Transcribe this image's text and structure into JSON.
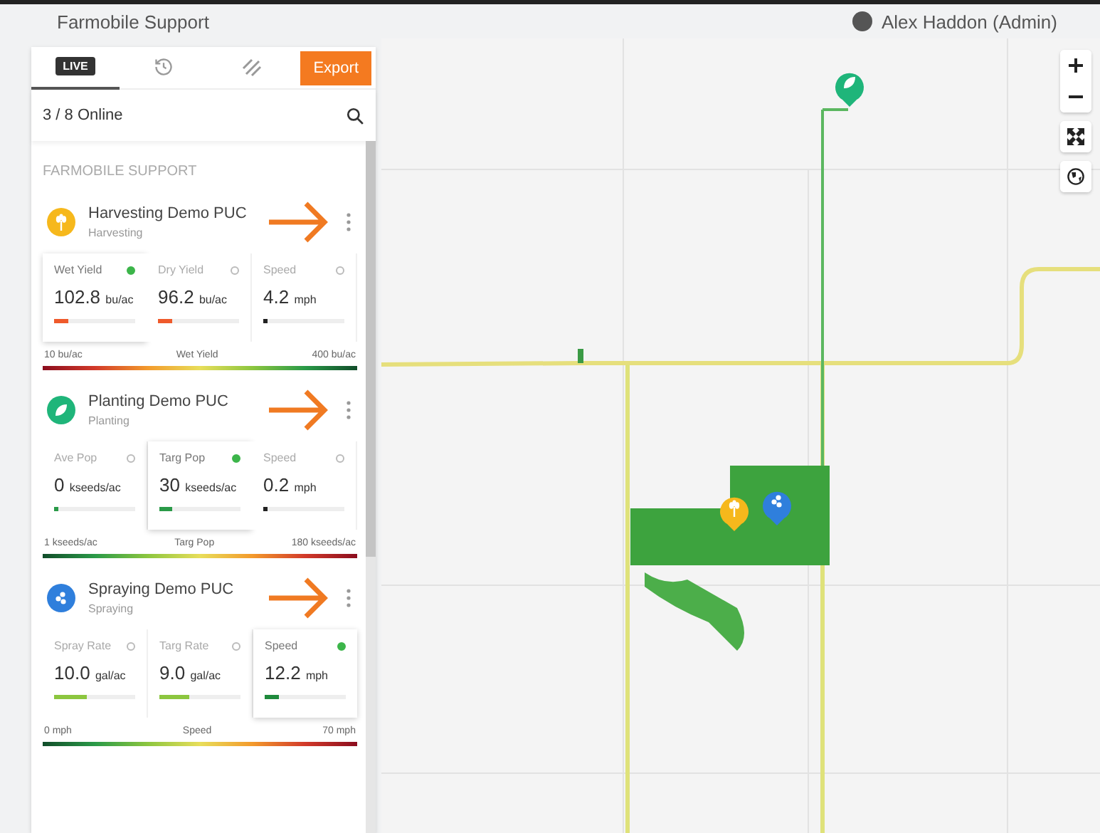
{
  "header": {
    "title": "Farmobile Support",
    "user": "Alex Haddon (Admin)"
  },
  "tabs": [
    {
      "kind": "badge",
      "label": "LIVE",
      "selected": true
    },
    {
      "kind": "history",
      "selected": false
    },
    {
      "kind": "stripes",
      "selected": false
    }
  ],
  "export_button": "Export",
  "online_count": "3 / 8 Online",
  "group_title": "FARMOBILE SUPPORT",
  "machines": [
    {
      "kind": "harvesting",
      "color": "#f6b81c",
      "name": "Harvesting Demo PUC",
      "activity": "Harvesting",
      "metrics": [
        {
          "label": "Wet Yield",
          "value": "102.8",
          "unit": "bu/ac",
          "selected": true,
          "level": 0.18,
          "color": "#ef5a2b"
        },
        {
          "label": "Dry Yield",
          "value": "96.2",
          "unit": "bu/ac",
          "selected": false,
          "level": 0.17,
          "color": "#ef5a2b"
        },
        {
          "label": "Speed",
          "value": "4.2",
          "unit": "mph",
          "selected": false,
          "level": 0.03,
          "color": "#222222"
        }
      ],
      "scale": {
        "min": "10 bu/ac",
        "name": "Wet Yield",
        "max": "400 bu/ac",
        "low_end_red": true
      }
    },
    {
      "kind": "planting",
      "color": "#1fb57a",
      "name": "Planting Demo PUC",
      "activity": "Planting",
      "metrics": [
        {
          "label": "Ave Pop",
          "value": "0",
          "unit": "kseeds/ac",
          "selected": false,
          "level": 0,
          "color": "#2a9a48"
        },
        {
          "label": "Targ Pop",
          "value": "30",
          "unit": "kseeds/ac",
          "selected": true,
          "level": 0.15,
          "color": "#2a9a48"
        },
        {
          "label": "Speed",
          "value": "0.2",
          "unit": "mph",
          "selected": false,
          "level": 0,
          "color": "#222222"
        }
      ],
      "scale": {
        "min": "1 kseeds/ac",
        "name": "Targ Pop",
        "max": "180 kseeds/ac",
        "low_end_red": false
      }
    },
    {
      "kind": "spraying",
      "color": "#2f7fdc",
      "name": "Spraying Demo PUC",
      "activity": "Spraying",
      "metrics": [
        {
          "label": "Spray Rate",
          "value": "10.0",
          "unit": "gal/ac",
          "selected": false,
          "level": 0.4,
          "color": "#8cc63f"
        },
        {
          "label": "Targ Rate",
          "value": "9.0",
          "unit": "gal/ac",
          "selected": false,
          "level": 0.36,
          "color": "#8cc63f"
        },
        {
          "label": "Speed",
          "value": "12.2",
          "unit": "mph",
          "selected": true,
          "level": 0.17,
          "color": "#1e8a3c"
        }
      ],
      "scale": {
        "min": "0 mph",
        "name": "Speed",
        "max": "70 mph",
        "low_end_red": false
      }
    }
  ]
}
